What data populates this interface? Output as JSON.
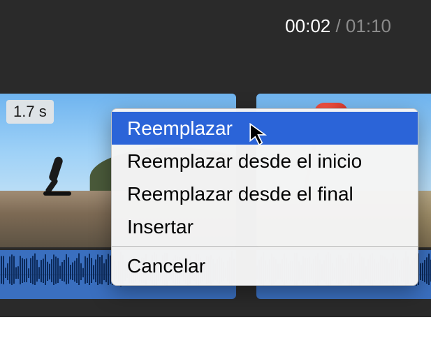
{
  "timecode": {
    "current": "00:02",
    "separator": " / ",
    "total": "01:10"
  },
  "clip": {
    "duration_label": "1.7 s"
  },
  "context_menu": {
    "items": [
      {
        "label": "Reemplazar",
        "selected": true
      },
      {
        "label": "Reemplazar desde el inicio",
        "selected": false
      },
      {
        "label": "Reemplazar desde el final",
        "selected": false
      },
      {
        "label": "Insertar",
        "selected": false
      }
    ],
    "cancel_label": "Cancelar"
  },
  "colors": {
    "menu_highlight": "#2b64d8",
    "clip_fill": "#3a6fbf",
    "background_dark": "#2a2a2a"
  },
  "icons": {
    "cursor": "mouse-pointer-icon"
  }
}
